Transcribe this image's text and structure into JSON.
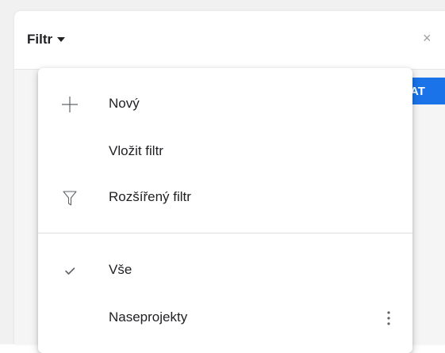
{
  "header": {
    "title": "Filtr",
    "close_glyph": "×"
  },
  "action_button": {
    "label": "AT",
    "color": "#1a73e8"
  },
  "menu": {
    "items": [
      {
        "icon": "plus-icon",
        "label": "Nový"
      },
      {
        "icon": "",
        "label": "Vložit filtr"
      },
      {
        "icon": "funnel-icon",
        "label": "Rozšířený filtr"
      }
    ],
    "saved_filters": [
      {
        "icon": "check-icon",
        "label": "Vše",
        "selected": true
      },
      {
        "icon": "",
        "label": "Naseprojekty",
        "has_menu": true,
        "menu_icon": "more-vert-icon"
      }
    ]
  }
}
